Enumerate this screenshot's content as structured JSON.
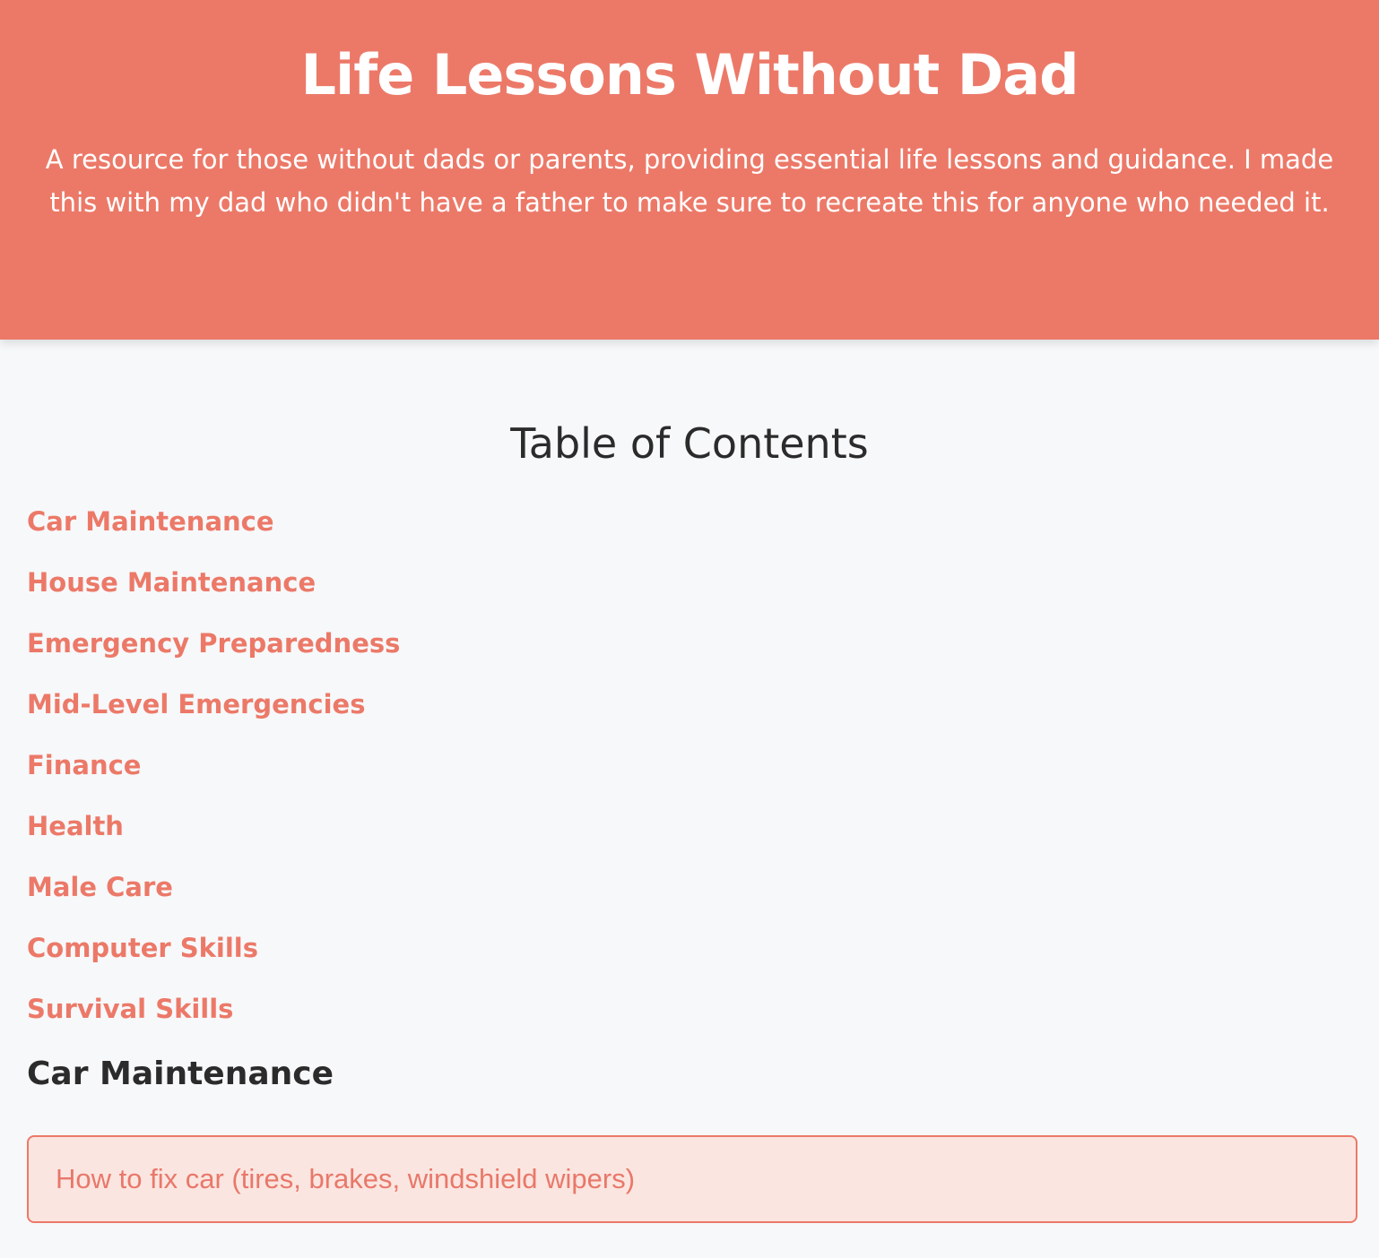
{
  "header": {
    "title": "Life Lessons Without Dad",
    "description": "A resource for those without dads or parents, providing essential life lessons and guidance. I made this with my dad who didn't have a father to make sure to recreate this for anyone who needed it."
  },
  "toc": {
    "title": "Table of Contents",
    "items": [
      {
        "label": "Car Maintenance"
      },
      {
        "label": "House Maintenance"
      },
      {
        "label": "Emergency Preparedness"
      },
      {
        "label": "Mid-Level Emergencies"
      },
      {
        "label": "Finance"
      },
      {
        "label": "Health"
      },
      {
        "label": "Male Care"
      },
      {
        "label": "Computer Skills"
      },
      {
        "label": "Survival Skills"
      }
    ]
  },
  "sections": [
    {
      "title": "Car Maintenance",
      "lessons": [
        {
          "label": "How to fix car (tires, brakes, windshield wipers)"
        }
      ]
    }
  ],
  "colors": {
    "accent": "#ec7968",
    "background": "#f7f8fa",
    "lesson_background": "#fbe5e0",
    "text": "#2b2b2b"
  }
}
